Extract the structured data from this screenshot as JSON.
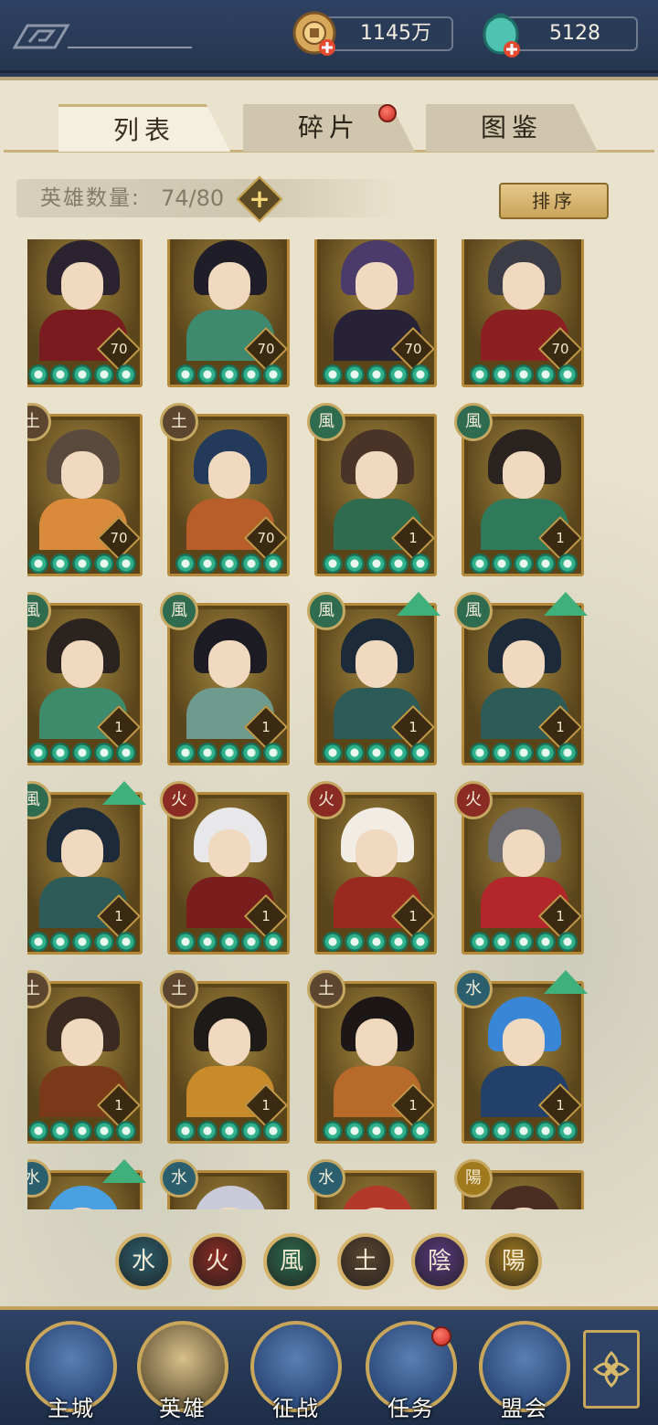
{
  "resources": {
    "coins": {
      "value": "1145万",
      "icon": "coin-icon"
    },
    "jade": {
      "value": "5128",
      "icon": "jade-bag-icon"
    }
  },
  "tabs": [
    {
      "label": "列表",
      "active": true
    },
    {
      "label": "碎片",
      "active": false,
      "badge": true
    },
    {
      "label": "图鉴",
      "active": false
    }
  ],
  "hero_count": {
    "label": "英雄数量:",
    "value": "74/80"
  },
  "sort_label": "排序",
  "heroes": [
    {
      "element": null,
      "level": "70",
      "upgrade": false,
      "hair": "#2b2430",
      "outfit": "#7a1b1f"
    },
    {
      "element": null,
      "level": "70",
      "upgrade": false,
      "hair": "#1e1d28",
      "outfit": "#3d8a6e"
    },
    {
      "element": null,
      "level": "70",
      "upgrade": false,
      "hair": "#4b3b6b",
      "outfit": "#272235"
    },
    {
      "element": null,
      "level": "70",
      "upgrade": false,
      "hair": "#3b3c45",
      "outfit": "#8b1f22"
    },
    {
      "element": "土",
      "level": "70",
      "upgrade": false,
      "hair": "#5a4a3e",
      "outfit": "#d98a3a"
    },
    {
      "element": "土",
      "level": "70",
      "upgrade": false,
      "hair": "#233a5a",
      "outfit": "#b85e2a"
    },
    {
      "element": "風",
      "level": "1",
      "upgrade": false,
      "hair": "#4a3428",
      "outfit": "#2f6b4e"
    },
    {
      "element": "風",
      "level": "1",
      "upgrade": false,
      "hair": "#2a2320",
      "outfit": "#2f7a5a"
    },
    {
      "element": "風",
      "level": "1",
      "upgrade": false,
      "hair": "#2a2320",
      "outfit": "#3d8b6a"
    },
    {
      "element": "風",
      "level": "1",
      "upgrade": false,
      "hair": "#1d1c24",
      "outfit": "#6f9a8e"
    },
    {
      "element": "風",
      "level": "1",
      "upgrade": true,
      "hair": "#1c2a3a",
      "outfit": "#2c5b58"
    },
    {
      "element": "風",
      "level": "1",
      "upgrade": true,
      "hair": "#1c2a3a",
      "outfit": "#2c5b58"
    },
    {
      "element": "風",
      "level": "1",
      "upgrade": true,
      "hair": "#1c2a3a",
      "outfit": "#2c5b58"
    },
    {
      "element": "火",
      "level": "1",
      "upgrade": false,
      "hair": "#e8e8ea",
      "outfit": "#7a1d1d"
    },
    {
      "element": "火",
      "level": "1",
      "upgrade": false,
      "hair": "#f1ece4",
      "outfit": "#9a2a20"
    },
    {
      "element": "火",
      "level": "1",
      "upgrade": false,
      "hair": "#6b6b70",
      "outfit": "#b3262b"
    },
    {
      "element": "土",
      "level": "1",
      "upgrade": false,
      "hair": "#3a2a22",
      "outfit": "#7a3a1a"
    },
    {
      "element": "土",
      "level": "1",
      "upgrade": false,
      "hair": "#1e1a18",
      "outfit": "#c98a2a"
    },
    {
      "element": "土",
      "level": "1",
      "upgrade": false,
      "hair": "#1c1616",
      "outfit": "#b76a2a"
    },
    {
      "element": "水",
      "level": "1",
      "upgrade": true,
      "hair": "#3a86d6",
      "outfit": "#23406b"
    },
    {
      "element": "水",
      "level": null,
      "upgrade": true,
      "hair": "#4aa0e0",
      "outfit": "#2a5f8b"
    },
    {
      "element": "水",
      "level": null,
      "upgrade": false,
      "hair": "#c9ccd8",
      "outfit": "#6a6e8a"
    },
    {
      "element": "水",
      "level": null,
      "upgrade": false,
      "hair": "#b33a2a",
      "outfit": "#7a1d1d"
    },
    {
      "element": "陽",
      "level": null,
      "upgrade": false,
      "hair": "#4a2e22",
      "outfit": "#6a4a2a"
    }
  ],
  "element_colors": {
    "水": "#2c5f6e",
    "火": "#8a2c24",
    "風": "#2f6b4e",
    "土": "#5c4630",
    "陰": "#5a3a7e",
    "陽": "#a27a1e"
  },
  "filters": [
    "水",
    "火",
    "風",
    "土",
    "陰",
    "陽"
  ],
  "nav": [
    {
      "label": "主城",
      "icon": "city-gate-icon"
    },
    {
      "label": "英雄",
      "icon": "hero-portrait-icon"
    },
    {
      "label": "征战",
      "icon": "battle-scroll-icon"
    },
    {
      "label": "任务",
      "icon": "quest-scroll-icon",
      "badge": true
    },
    {
      "label": "盟会",
      "icon": "guild-pavilion-icon"
    }
  ],
  "menu_icon": "lattice-menu-icon"
}
